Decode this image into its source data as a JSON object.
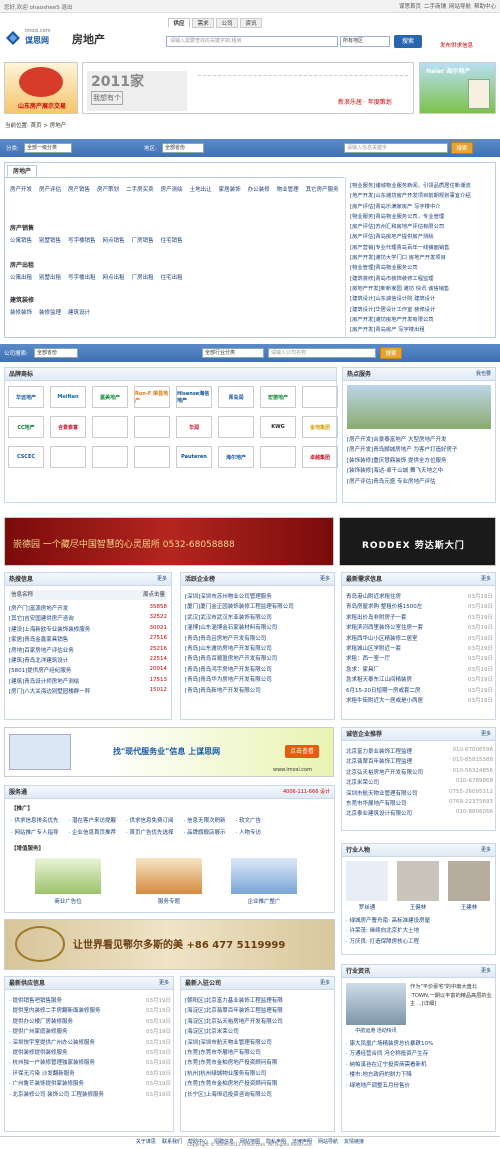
{
  "topbar": {
    "left_text": "您好,欢迎 ohaosheeS 退出",
    "links": [
      "谋思首页",
      "二手商铺",
      "网站导航",
      "帮助中心"
    ]
  },
  "header": {
    "logo_small": "imosi.com",
    "logo_big": "谋思网",
    "section": "房地产",
    "tabs": [
      "供应",
      "需求",
      "公司",
      "资讯"
    ],
    "search_placeholder": "请输入需要查找的关键字如:租房",
    "region": "所有地区",
    "search_button": "搜索",
    "publish": "发布供求信息"
  },
  "banners": {
    "b1": "山东房产展示交易",
    "b2_title": "2011家",
    "b2_sub": "我想有个",
    "b2_text": "新浪乐居 · 年度策划",
    "b3": "Haier 海尔地产"
  },
  "breadcrumb": "当前位置: 首页 > 房地产",
  "filter1": {
    "cat_label": "分类:",
    "cat_value": "全部一级分类",
    "area_label": "地区:",
    "area_value": "全部省份",
    "placeholder": "请输入信息关键字",
    "button": "搜索"
  },
  "categories": {
    "tab": "房地产",
    "row1": [
      "房产开发",
      "房产评估",
      "房产销售",
      "房产策划",
      "二手房买卖",
      "房产测绘",
      "土地出让",
      "家居装饰",
      "办公装修",
      "物业管理",
      "其它房产服务"
    ],
    "h2": "房产销售",
    "row2": [
      "公寓销售",
      "别墅销售",
      "写字楼销售",
      "网点销售",
      "厂房销售",
      "住宅销售"
    ],
    "h3": "房产出租",
    "row3": [
      "公寓出租",
      "别墅出租",
      "写字楼出租",
      "网点出租",
      "厂房出租",
      "住宅出租"
    ],
    "h4": "建筑装修",
    "row4": [
      "装修装饰",
      "装修监理",
      "建筑设计"
    ],
    "news": [
      "[物业服务]诸城物业服务新闻，引领品质居住新潮流",
      "[地产开发]山东潍坊房产开发项目前期规划事宜介绍",
      "[房产评估]青岛乐满家房产 写字楼中介",
      "[物业服务]青岛物业服务公司，专业管理",
      "[房产评估]苏州汇和房地产评估有限公司",
      "[房产评估]青岛房地产提供房产测绘",
      "[房产营销]专业代理青岛百年一线铺面销售",
      "[房产开发]潍坊大学门口 房地产开发项目",
      "[物业管理]青岛物业服务公司",
      "[建筑装修]青岛市装饰装修工程监理",
      "[房地产开发]新新家园 潍坊 快讯 诚信销售",
      "[建筑设计]山东诚信设计院 建筑设计",
      "[建筑设计]华居设计工作室 装修设计",
      "[房产开发]潍坊房地产开发有限公司",
      "[房产开发]青岛房产 写字楼出租"
    ]
  },
  "filter2": {
    "label": "公司搜索:",
    "area": "全部省份",
    "industry": "全部行业分类",
    "placeholder": "请输入公司名称",
    "button": "搜索"
  },
  "brands": {
    "title": "品牌商标",
    "logos": [
      "华远地产",
      "MeiNan",
      "嘉美地产",
      "Ron-F 荣昌地产",
      "Hisense海信地产",
      "青岛润",
      "宏德地产",
      "",
      "CC地产",
      "合景泰富",
      "",
      "",
      "华润",
      "",
      "KWG",
      "金地集团",
      "CSCEC",
      "",
      "",
      "",
      "Pauteren",
      "海尔地产",
      "",
      "卓越集团"
    ]
  },
  "hot": {
    "title": "热点服务",
    "more": "我也要",
    "items": [
      "[房产开发]合景泰富地产 大型房地产开发",
      "[房产开发]青岛郦城房地产 为客户打造好房子",
      "[装饰装修]重庆慧鼎装饰 提供全方位服务",
      "[装饰装修]海达-卓千山城 舞飞天地之中",
      "[房产评估]青岛元盛 专业房地产评估"
    ]
  },
  "ad_banner": {
    "left": "崇德园 一个藏尽中国智慧的心灵居所 0532-68058888",
    "right": "RODDEX 劳达斯大门"
  },
  "supply": {
    "title": "热搜信息",
    "more": "更多",
    "col1": "信息名称",
    "col2": "周点击量",
    "items": [
      [
        "[房产门]富源房地产开发",
        "35858"
      ],
      [
        "[其它]吉安国建供房产咨询",
        "32522"
      ],
      [
        "[建设]上海新欧专业装饰装修服务",
        "30021"
      ],
      [
        "[家居]青岛金鑫家具销售",
        "27516"
      ],
      [
        "[房地]百家房地产评估业务",
        "25216"
      ],
      [
        "[建筑]青岛北洋建筑设计",
        "22514"
      ],
      [
        "[5801]提供房产经纪服务",
        "20014"
      ],
      [
        "[建筑]青岛设计师房地产测绘",
        "17513"
      ],
      [
        "[房门]八大关海边别墅园楼群一秤",
        "15012"
      ]
    ]
  },
  "companies": {
    "title": "活跃企业榜",
    "more": "更多",
    "items": [
      "[深圳]深圳市苏州物业公司管理服务",
      "[厦门]厦门金正园装饰装修工程监理有限公司",
      "[武汉]武汉市武汉东亚装饰有限公司",
      "[淄博]山东淄博金石家装材料有限公司",
      "[青岛]青岛吕房地产开发有限公司",
      "[青岛]山东潍坊房地产开发有限公司",
      "[青岛]青岛百顺盈房地产开发有限公司",
      "[青岛]青岛鸿宇房地产开发有限公司",
      "[青岛]青岛华为房地产开发有限公司",
      "[青岛]青岛新地产开发有限公司"
    ]
  },
  "demand": {
    "title": "最新需求信息",
    "more": "更多",
    "items": [
      [
        "青岛港山附近求租住房",
        "03月19日"
      ],
      [
        "青岛房屋求购 整租价格1500左",
        "03月19日"
      ],
      [
        "求租出价岛非附房子一套",
        "03月19日"
      ],
      [
        "求租滨河西里装饰公室住房一套",
        "03月19日"
      ],
      [
        "求租西华山小区精装修二居室",
        "03月19日"
      ],
      [
        "求租城山区学附近一套",
        "03月19日"
      ],
      [
        "求租：西一室一厅",
        "03月19日"
      ],
      [
        "急求：家具厂",
        "03月19日"
      ],
      [
        "急求租天泰东江山间精装房",
        "03月19日"
      ],
      [
        "6月15-20日短期一房或套二房",
        "03月19日"
      ],
      [
        "求租牛街附近大一居或是小两居",
        "03月19日"
      ]
    ]
  },
  "service_ad": {
    "text": "找\"现代服务业\"信息 上谋思网",
    "btn": "点击查看",
    "url": "www.imosi.com"
  },
  "integrity": {
    "title": "诚信企业推荐",
    "more": "更多",
    "items": [
      [
        "北京富力景业装饰工程监理",
        "010-67006596"
      ],
      [
        "北京翡翠百年装饰工程监理",
        "010-85815588"
      ],
      [
        "北京弘天裕房地产开发有限公司",
        "010-56324856"
      ],
      [
        "北京米荣公司",
        "010-6789868"
      ],
      [
        "深圳市航天物业管理有限公司",
        "0755-26095112"
      ],
      [
        "东莞市华展地产有限公司",
        "0769-22375693"
      ],
      [
        "北京泰业建筑设计有限公司",
        "010-8806066"
      ]
    ]
  },
  "services": {
    "title": "服务通",
    "phone": "4006-111-666 设计",
    "sub1": "【推广】",
    "row1": [
      "· 供求信息排名优先",
      "· 潜在客户来访提醒",
      "· 供求信息免费订阅",
      "· 信息无限次刷新",
      "· 软文广告"
    ],
    "row2": [
      "· 网站推广专人指导",
      "· 企业信息首页推荐",
      "· 首页广告优先选择",
      "· 品牌旗舰店展示",
      "· 人物专访"
    ],
    "sub2": "【增值服务】",
    "cards": [
      "商业广告位",
      "服务专题",
      "企业推广整广"
    ]
  },
  "persons": {
    "title": "行业人物",
    "more": "更多",
    "names": [
      "罗丝通",
      "王健林",
      "王建林"
    ],
    "items": [
      "· 绿城房产曹舟南: 高标准建设房屋",
      "· 许荣茂: 继续向北京扩大土地",
      "· 万庆良: 打造保障房核心工程"
    ]
  },
  "ordos_ad": "让世界看见鄂尔多斯的美 +86 477 5119999",
  "supply2": {
    "title": "最新供应信息",
    "more": "更多",
    "items": [
      [
        "· 提供销售吧销售服务",
        "03月19日"
      ],
      [
        "· 提供室内装修二手房翻新面装修服务",
        "03月19日"
      ],
      [
        "· 提供办公楼厂房装修服务",
        "03月19日"
      ],
      [
        "· 提供广州家庭装修服务",
        "03月19日"
      ],
      [
        "· 深圳快宇室提供广州办公装修服务",
        "03月19日"
      ],
      [
        "· 提供装修提供装修服务",
        "03月19日"
      ],
      [
        "· 杭州独一户装修管理独家装修服务",
        "03月19日"
      ],
      [
        "· 环保无污染 沙发翻新服务",
        "03月19日"
      ],
      [
        "· 广州鲁芒装饰提供家装修服务",
        "03月19日"
      ],
      [
        "· 北京装修公司 装饰公司 工程装修服务",
        "03月19日"
      ]
    ]
  },
  "joined": {
    "title": "最新入驻公司",
    "more": "更多",
    "items": [
      "[朝阳区]北京富力基业装饰工程监理有限",
      "[海淀区]北京翡翠百年装饰工程监理有限",
      "[海淀区]北京弘天裕房地产开发有限公司",
      "[海淀区]北京米荣公司",
      "[深圳]深圳市航天物业管理有限公司",
      "[东莞]东莞市华展地产有限公司",
      "[东莞]东莞市金柏房地产投资顾问有限",
      "[杭州]杭州绿城物业服务有限公司",
      "[东莞]东莞市金柏房地产投资顾问有限",
      "[长宁区]上海恒远投资咨询有限公司"
    ]
  },
  "news": {
    "title": "行业资讯",
    "more": "更多",
    "caption": "中航运港 活动快讯",
    "lead": "作为\"平价豪宅\"的中南大盘北·TOWN,一期以丰富的精品高层的业主 ...[详细]",
    "items": [
      "· 康大凤凰广场精装房总价暴跌10%",
      "· 万通经营合同 冯仑称投资产生存",
      "· 纳帕溪谷在辽宁投资商需看新机",
      "· 楼市:地方政府的财力下降",
      "· 绿地地产调整五月份售价"
    ]
  },
  "footer": {
    "links": [
      "关于谋思",
      "联系我们",
      "帮助中心",
      "招聘信息",
      "网站地图",
      "隐私声明",
      "法律声明",
      "网站导航",
      "友情链接"
    ],
    "copyright": "Copyright © 2009-2011 imosi.com. All Rights Reserved."
  }
}
